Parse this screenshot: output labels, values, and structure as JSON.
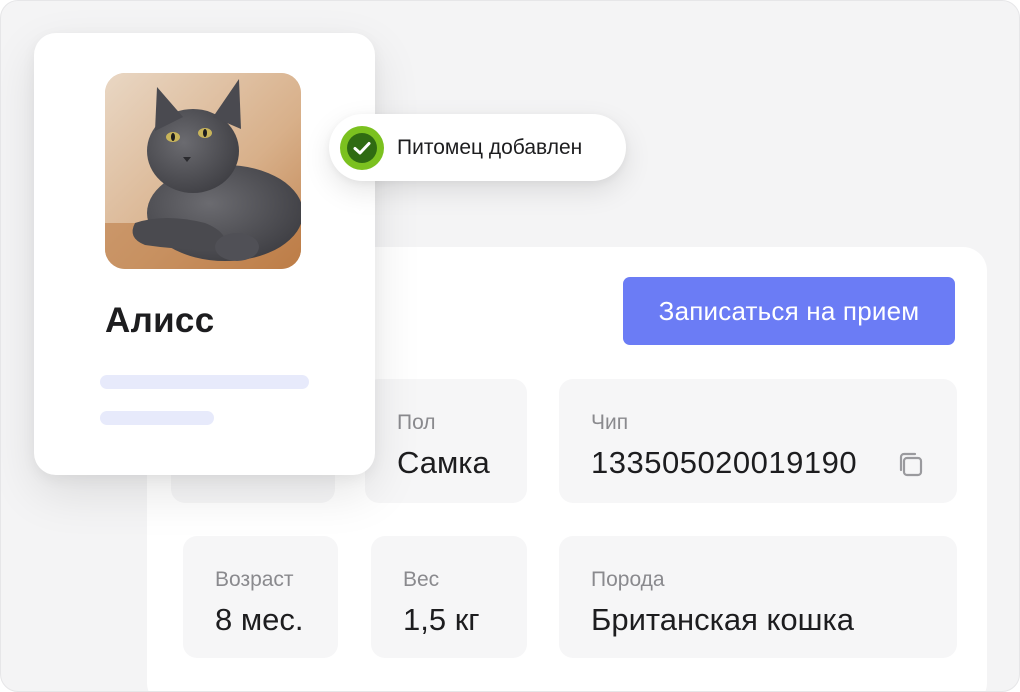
{
  "toast": {
    "message": "Питомец добавлен",
    "icon": "check-circle-icon",
    "color": "#7bc11f"
  },
  "pet": {
    "name": "Алисс",
    "photo": "cat-photo"
  },
  "actions": {
    "book_label": "Записаться на прием",
    "accent": "#6b7cf5"
  },
  "details": {
    "sex": {
      "label": "Пол",
      "value": "Самка"
    },
    "chip": {
      "label": "Чип",
      "value": "133505020019190",
      "icon": "copy-icon"
    },
    "age": {
      "label": "Возраст",
      "value": "8 мес."
    },
    "weight": {
      "label": "Вес",
      "value": "1,5 кг"
    },
    "breed": {
      "label": "Порода",
      "value": "Британская кошка"
    }
  }
}
